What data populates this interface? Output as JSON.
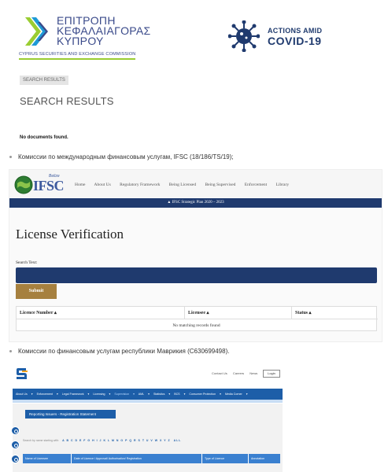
{
  "header": {
    "cysec": {
      "line1": "ΕΠΙΤΡΟΠΗ",
      "line2": "ΚΕΦΑΛΑΙΑΓΟΡΑΣ",
      "line3": "ΚΥΠΡΟΥ",
      "subtitle": "CYPRUS SECURITIES AND EXCHANGE COMMISSION",
      "colors": {
        "brand": "#3a4a8a",
        "accent": "#9acd32"
      }
    },
    "covid": {
      "line1": "ACTIONS AMID",
      "line2": "COVID-19",
      "icon": "virus-icon",
      "color": "#1f3a6e"
    }
  },
  "breadcrumb": "SEARCH RESULTS",
  "page_title": "SEARCH RESULTS",
  "no_docs": "No documents found.",
  "bullets": [
    "Комиссии по международным финансовым услугам, IFSC (18/186/TS/19);",
    "Комиссии по финансовым услугам республики Маврикия (C630699498)."
  ],
  "ifsc": {
    "logo_text": "IFSC",
    "logo_small": "Belize",
    "menu": [
      "Home",
      "About Us",
      "Regulatory Framework",
      "Being Licensed",
      "Being Supervised",
      "Enforcement",
      "Library"
    ],
    "banner": "IFSC Strategic Plan 2020 – 2023",
    "heading": "License Verification",
    "search_label": "Search Text:",
    "submit": "Submit",
    "columns": [
      "Licence Number",
      "Licensee",
      "Status"
    ],
    "empty": "No matching records found",
    "colors": {
      "navy": "#1f3a6e",
      "gold": "#a6803f"
    }
  },
  "fsc": {
    "toplinks": [
      "Contact Us",
      "Careers",
      "News"
    ],
    "login": "Login",
    "menu": [
      "About Us",
      "Enforcement",
      "Legal Framework",
      "Licensing",
      "Supervision",
      "AML",
      "Statistics",
      "BCS",
      "Consumer Protection",
      "Media Corner"
    ],
    "menu_active": "Supervision",
    "report_button": "Reporting Issuers - Registration Statement",
    "alpha_label": "Search by name starting with:",
    "alpha_letters": "A B C D E F G H I J K L M N O P Q R S T U V W X Y Z",
    "alpha_all": "ALL",
    "columns": [
      "Name of Licensee",
      "Date of Licence / Approval/ Authorisation/ Registration",
      "Type of Licence",
      "Annotation"
    ],
    "colors": {
      "blue": "#1d5ea8",
      "header": "#3a80d0"
    }
  }
}
